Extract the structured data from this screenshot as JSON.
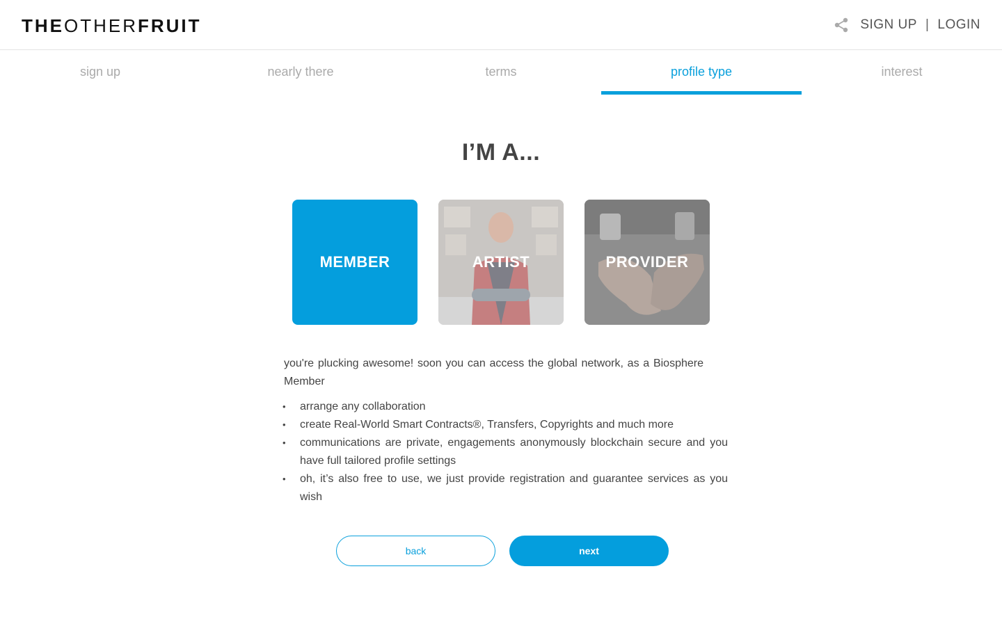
{
  "header": {
    "logo_parts": [
      "THE",
      "OTHER",
      "FRUIT"
    ],
    "share_icon": "share-icon",
    "signup_label": "SIGN UP",
    "separator": "|",
    "login_label": "LOGIN"
  },
  "steps": [
    {
      "label": "sign up",
      "active": false
    },
    {
      "label": "nearly there",
      "active": false
    },
    {
      "label": "terms",
      "active": false
    },
    {
      "label": "profile type",
      "active": true
    },
    {
      "label": "interest",
      "active": false
    }
  ],
  "title": "I’M A...",
  "cards": [
    {
      "label": "MEMBER",
      "selected": true
    },
    {
      "label": "ARTIST",
      "selected": false
    },
    {
      "label": "PROVIDER",
      "selected": false
    }
  ],
  "description": "you're plucking awesome! soon you can access the global network, as a Biosphere Member",
  "bullets": [
    "arrange any collaboration",
    "create Real-World Smart Contracts®, Transfers, Copyrights and much more",
    "communications are private, engagements anonymously blockchain secure and you have full tailored profile settings",
    "oh, it’s also free to use, we just provide registration and guarantee services as you wish"
  ],
  "buttons": {
    "back_label": "back",
    "next_label": "next"
  },
  "colors": {
    "accent": "#049edd",
    "step_inactive": "#aaaaaa",
    "text": "#444444"
  }
}
